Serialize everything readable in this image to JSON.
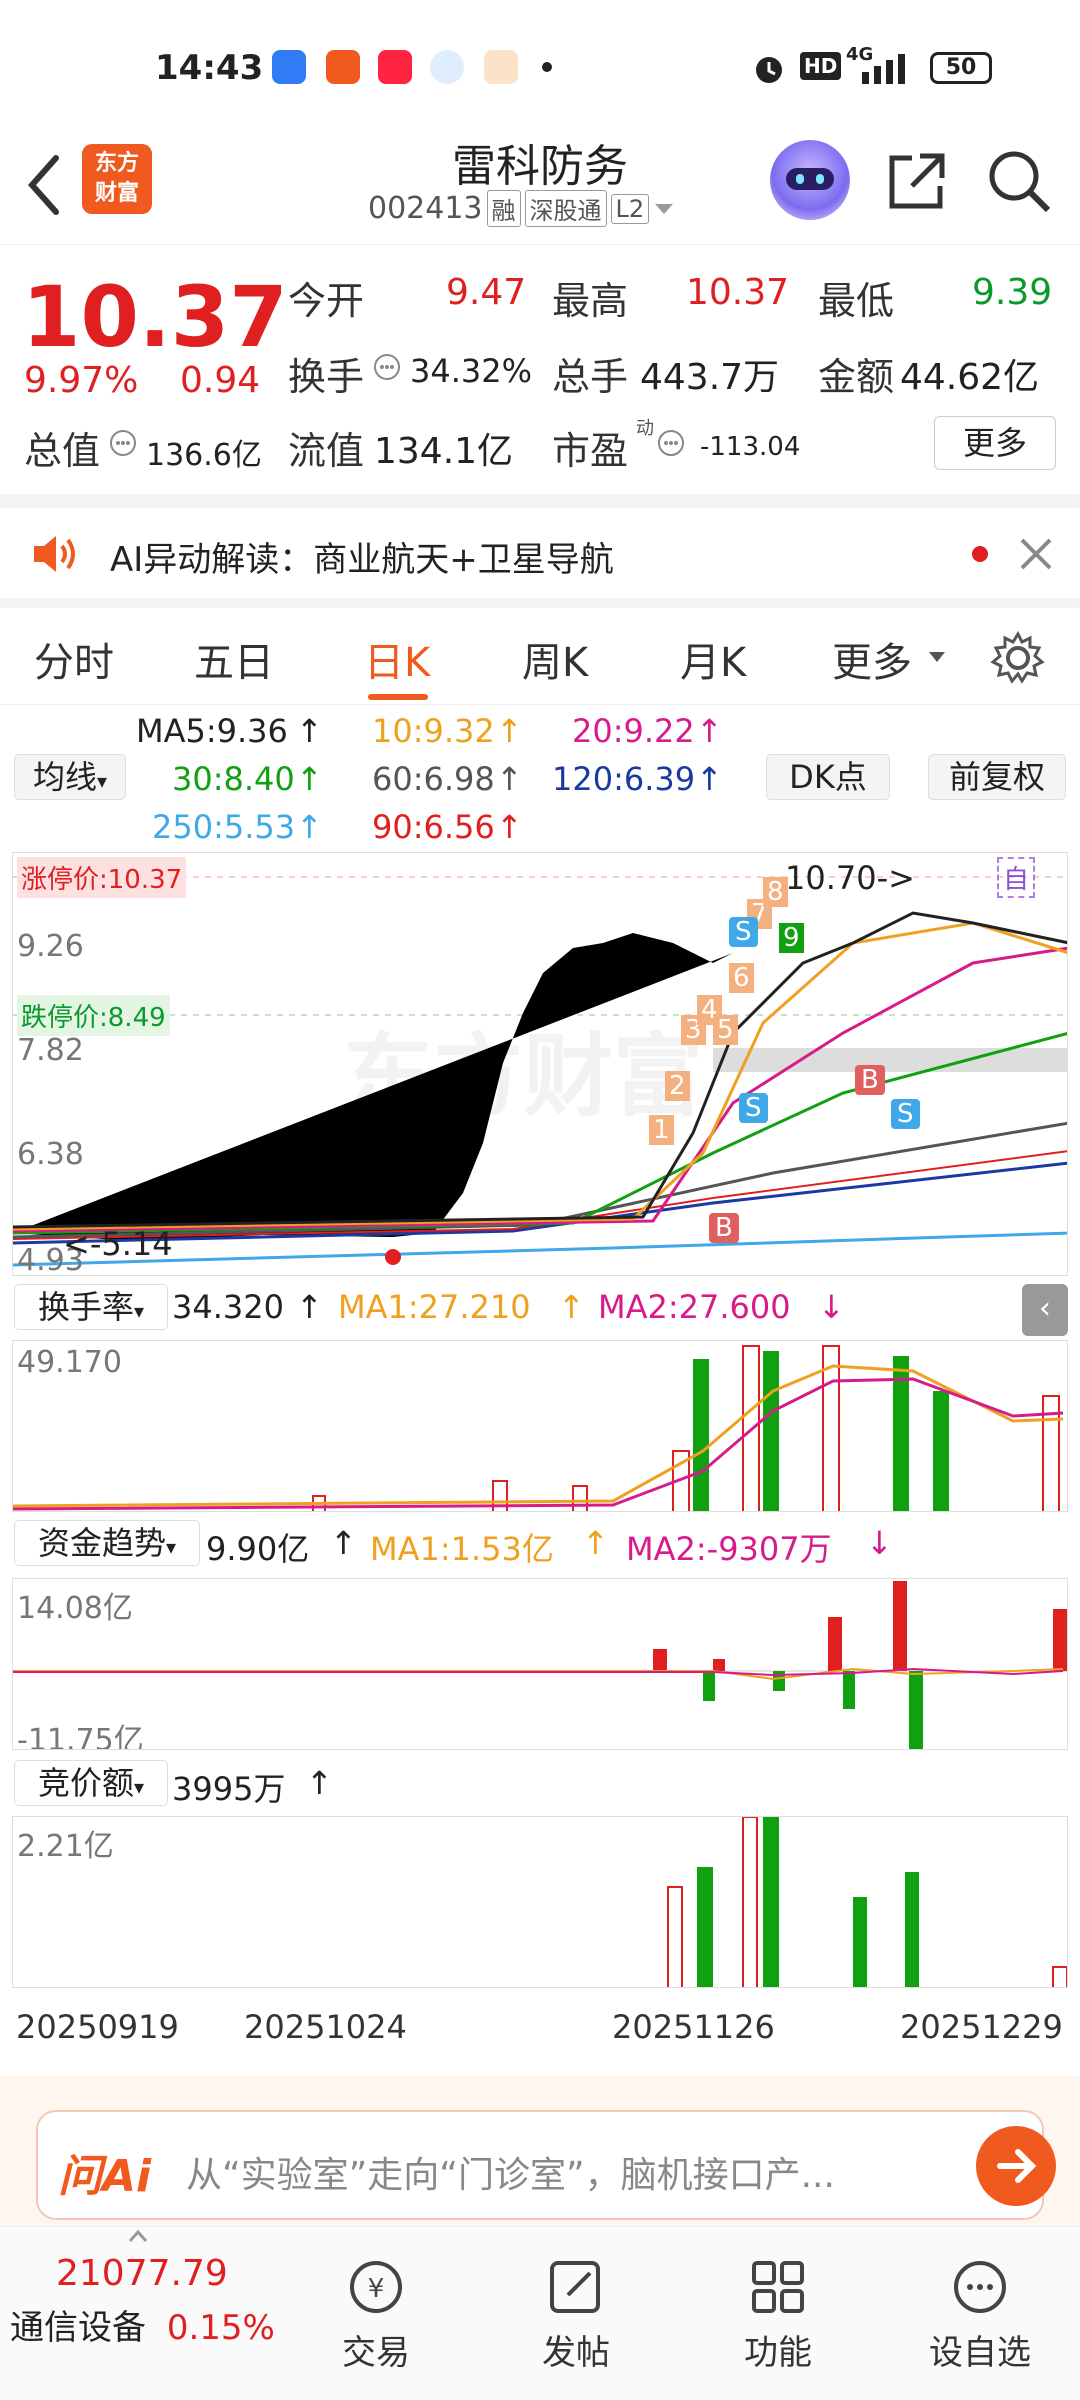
{
  "status_bar": {
    "time": "14:43",
    "battery": "50",
    "network": "4G",
    "hd": "HD"
  },
  "header": {
    "logo_line1": "东方",
    "logo_line2": "财富",
    "stock_name": "雷科防务",
    "stock_code": "002413",
    "tags": [
      "融",
      "深股通",
      "L2"
    ]
  },
  "quote": {
    "price": "10.37",
    "change_pct": "9.97%",
    "change_abs": "0.94",
    "open_label": "今开",
    "open": "9.47",
    "high_label": "最高",
    "high": "10.37",
    "low_label": "最低",
    "low": "9.39",
    "turnover_label": "换手",
    "turnover": "34.32%",
    "volume_label": "总手",
    "volume": "443.7万",
    "amount_label": "金额",
    "amount": "44.62亿",
    "mcap_label": "总值",
    "mcap": "136.6亿",
    "float_label": "流值",
    "float_cap": "134.1亿",
    "pe_label": "市盈",
    "pe_sup": "动",
    "pe": "-113.04",
    "more": "更多"
  },
  "ai_bar": {
    "text": "AI异动解读：商业航天+卫星导航"
  },
  "tabs": [
    "分时",
    "五日",
    "日K",
    "周K",
    "月K",
    "更多"
  ],
  "active_tab": "日K",
  "ma_legend": {
    "btn": "均线",
    "ma5": "MA5:9.36",
    "ma10": "10:9.32",
    "ma20": "20:9.22",
    "ma30": "30:8.40",
    "ma60": "60:6.98",
    "ma120": "120:6.39",
    "ma250": "250:5.53",
    "ma90": "90:6.56",
    "dk": "DK点",
    "fq": "前复权"
  },
  "kline": {
    "limit_up": "涨停价:10.37",
    "limit_down": "跌停价:8.49",
    "y_labels": [
      "9.26",
      "7.82",
      "6.38",
      "4.93"
    ],
    "high_mark": "10.70->",
    "low_mark": "<-5.14",
    "markers_num": [
      "1",
      "2",
      "3",
      "4",
      "5",
      "6",
      "7",
      "8",
      "9"
    ],
    "marker_zi": "自",
    "colors": {
      "ma5": "#222222",
      "ma10": "#f0a020",
      "ma20": "#d81b8a",
      "ma30": "#10a010",
      "ma60": "#555555",
      "ma120": "#1a3aa0",
      "ma250": "#3fa8e8"
    }
  },
  "turnover_panel": {
    "label": "换手率",
    "value": "34.320",
    "ma1": "MA1:27.210",
    "ma2": "MA2:27.600",
    "ymax": "49.170"
  },
  "fund_panel": {
    "label": "资金趋势",
    "value": "9.90亿",
    "ma1": "MA1:1.53亿",
    "ma2": "MA2:-9307万",
    "ymax": "14.08亿",
    "ymin": "-11.75亿"
  },
  "auction_panel": {
    "label": "竞价额",
    "value": "3995万",
    "ymax": "2.21亿"
  },
  "x_axis": [
    "20250919",
    "20251024",
    "20251126",
    "20251229"
  ],
  "ask_bar": {
    "brand": "问Ai",
    "text": "从“实验室”走向“门诊室”，脑机接口产..."
  },
  "bottom_nav": {
    "index_value": "21077.79",
    "index_name": "通信设备",
    "index_change": "0.15%",
    "items": [
      "交易",
      "发帖",
      "功能",
      "设自选"
    ]
  }
}
